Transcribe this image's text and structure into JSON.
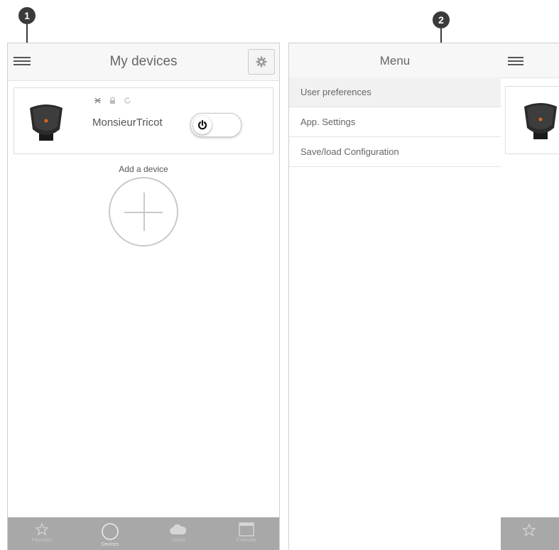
{
  "callouts": [
    "1",
    "2"
  ],
  "screen1": {
    "title": "My devices",
    "device": {
      "name": "MonsieurTricot",
      "status_icons": [
        "signal-icon",
        "lock-icon",
        "refresh-icon"
      ]
    },
    "add_label": "Add a device",
    "tabs": [
      {
        "icon": "star-icon",
        "label": "Favorites"
      },
      {
        "icon": "circle-icon",
        "label": "Devices"
      },
      {
        "icon": "cloud-icon",
        "label": "Cloud"
      },
      {
        "icon": "calendar-icon",
        "label": "Calendar"
      }
    ],
    "active_tab": 1
  },
  "screen2": {
    "menu_title": "Menu",
    "menu_items": [
      "User preferences",
      "App. Settings",
      "Save/load Configuration"
    ],
    "selected_item": 0
  },
  "colors": {
    "tabbar": "#a8a8a8",
    "header": "#f7f7f7",
    "callout": "#3a3a3a"
  }
}
